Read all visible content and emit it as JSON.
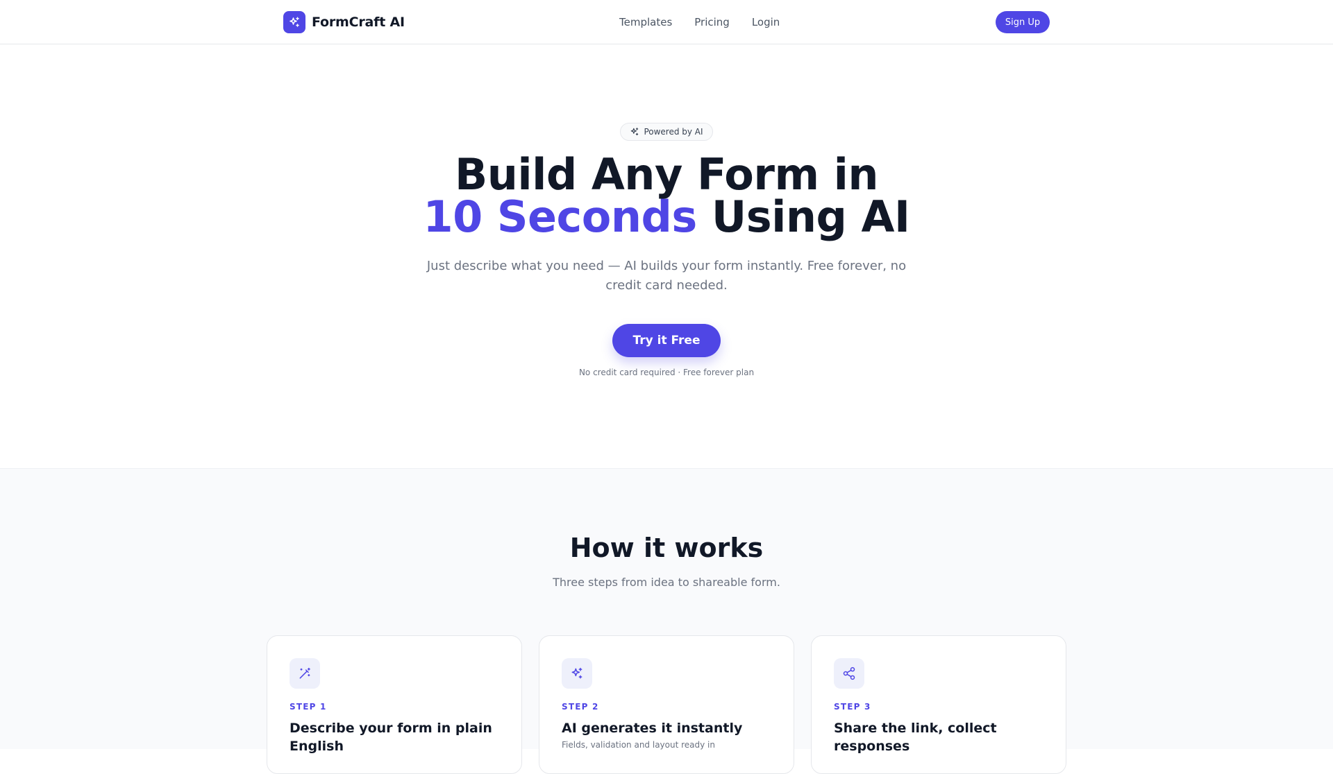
{
  "header": {
    "brand_name": "FormCraft AI",
    "brand_icon": "sparkles-icon",
    "nav": [
      {
        "label": "Templates"
      },
      {
        "label": "Pricing"
      },
      {
        "label": "Login"
      }
    ],
    "signup_label": "Sign Up"
  },
  "hero": {
    "badge": {
      "icon": "sparkles-icon",
      "label": "Powered by AI"
    },
    "headline_line1": "Build Any Form in",
    "headline_accent": "10 Seconds",
    "headline_rest": "Using AI",
    "subtitle": "Just describe what you need — AI builds your form instantly. Free forever, no credit card needed.",
    "cta_label": "Try it Free",
    "fineprint": "No credit card required · Free forever plan"
  },
  "how_it_works": {
    "title": "How it works",
    "subtitle": "Three steps from idea to shareable form.",
    "steps": [
      {
        "icon": "magic-wand-icon",
        "step": "STEP 1",
        "title": "Describe your form in plain English",
        "desc": ""
      },
      {
        "icon": "sparkles-icon",
        "step": "STEP 2",
        "title": "AI generates it instantly",
        "desc": "Fields, validation and layout ready in"
      },
      {
        "icon": "share-icon",
        "step": "STEP 3",
        "title": "Share the link, collect responses",
        "desc": ""
      }
    ]
  },
  "colors": {
    "accent": "#4f46e5",
    "text": "#111827",
    "muted": "#6b7280",
    "section_bg": "#f9fafc"
  }
}
